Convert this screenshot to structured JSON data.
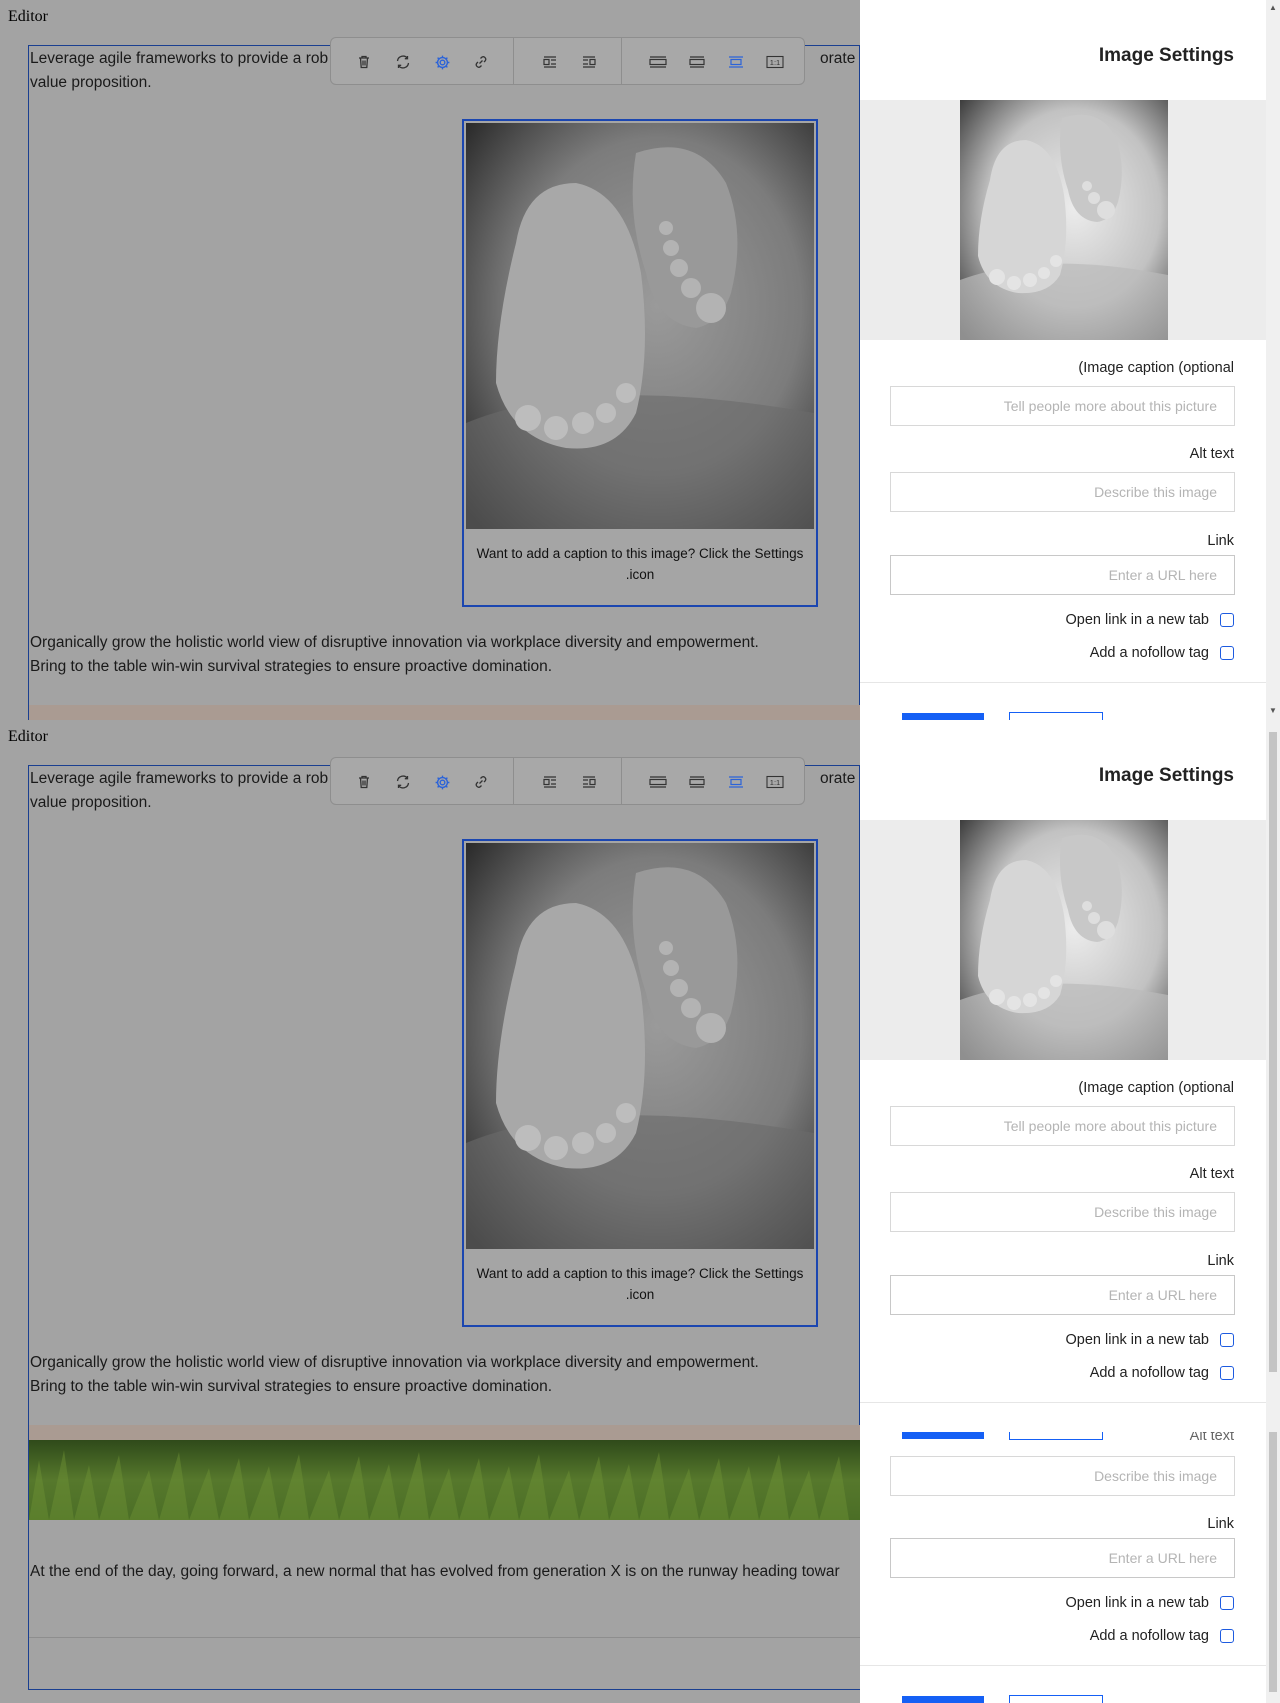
{
  "editor": {
    "label": "Editor",
    "paragraph1_line1": "Leverage agile frameworks to provide a rob",
    "paragraph1_tail": "orate stra",
    "paragraph1_line2": "value proposition.",
    "paragraph2_line1": "Organically grow the holistic world view of disruptive innovation via workplace diversity and empowerment.",
    "paragraph2_line2": "Bring to the table win-win survival strategies to ensure proactive domination.",
    "paragraph3": "At the end of the day, going forward, a new normal that has evolved from generation X is on the runway heading towar",
    "image_caption_line1": "Want to add a caption to this image? Click the Settings",
    "image_caption_line2": ".icon"
  },
  "toolbar": {
    "buttons": [
      "delete-icon",
      "replace-icon",
      "settings-icon",
      "link-icon",
      "align-left-icon",
      "align-right-icon",
      "full-width-icon",
      "best-fit-icon",
      "small-center-icon",
      "original-size-icon"
    ],
    "ratio_label": "1:1",
    "active_color": "#2b63d9"
  },
  "settings": {
    "title": "Image Settings",
    "caption_label": "(Image caption (optional",
    "caption_placeholder": "Tell people more about this picture",
    "alt_label": "Alt text",
    "alt_placeholder": "Describe this image",
    "link_label": "Link",
    "link_placeholder": "Enter a URL here",
    "new_tab_label": "Open link in a new tab",
    "nofollow_label": "Add a nofollow tag",
    "overlap_label": "Alt text"
  },
  "colors": {
    "accent": "#1560f5",
    "overlay": "#a3a3a3",
    "selection": "#1b46b0"
  }
}
